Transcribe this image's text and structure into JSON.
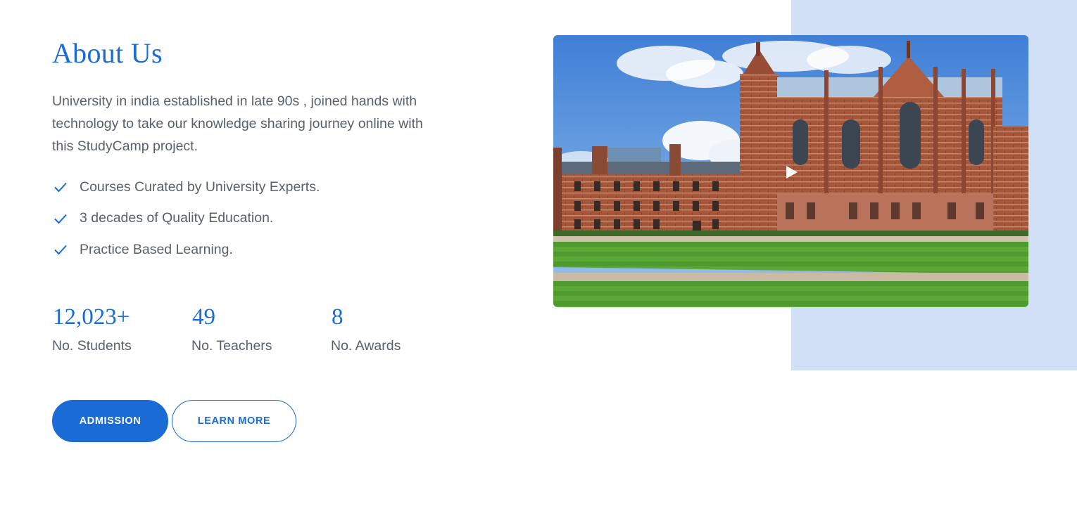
{
  "about": {
    "title": "About Us",
    "description": "University in india established in late 90s , joined hands with technology to take our knowledge sharing journey online with this StudyCamp project.",
    "features": [
      "Courses Curated by University Experts.",
      "3 decades of Quality Education.",
      "Practice Based Learning."
    ]
  },
  "stats": [
    {
      "value": "12,023+",
      "label": "No. Students"
    },
    {
      "value": "49",
      "label": "No. Teachers"
    },
    {
      "value": "8",
      "label": "No. Awards"
    }
  ],
  "buttons": {
    "admission": "ADMISSION",
    "learn_more": "LEARN MORE"
  },
  "media": {
    "image": "university-campus-photo",
    "play_icon": "play-icon"
  },
  "colors": {
    "accent": "#1a6bd6",
    "panel": "#d2e0f7",
    "text": "#5a606b"
  }
}
